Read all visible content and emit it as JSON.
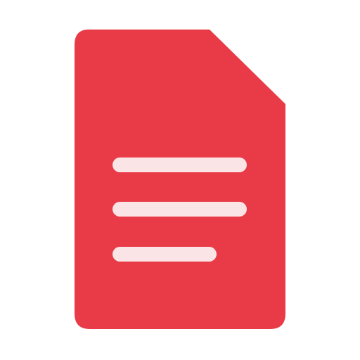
{
  "icon": {
    "name": "document-icon",
    "body_color": "#E83B47",
    "line_color": "#FBE4E6",
    "background_color": "#FFFFFF",
    "text_lines": 3
  }
}
